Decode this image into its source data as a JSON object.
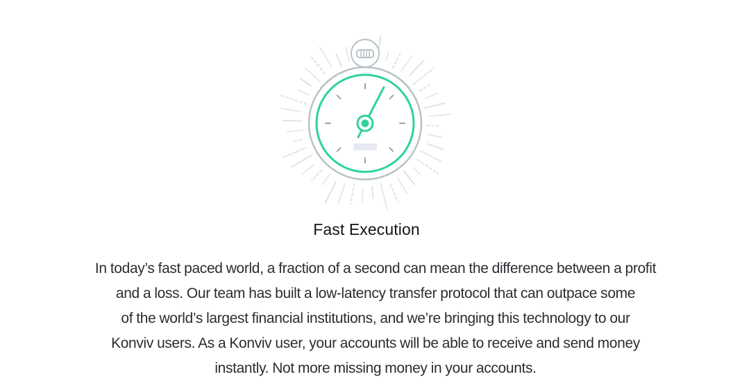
{
  "feature": {
    "icon": "stopwatch-icon",
    "title": "Fast Execution",
    "description_lines": [
      "In today’s fast paced world, a fraction of a second can mean the difference between a profit",
      "and a loss. Our team has built a low-latency transfer protocol that can outpace some",
      "of the world’s largest financial institutions, and we’re bringing this technology to our",
      "Konviv users. As a Konviv user, your accounts will be able to receive and send money",
      "instantly. Not more missing money in your accounts."
    ]
  },
  "colors": {
    "accent": "#2ed39a",
    "accent_dark": "#1f9e72",
    "outline": "#b7c2c7",
    "ray": "#dfe5e8",
    "tick": "#9aa5ab",
    "display": "#e7eaf3"
  }
}
